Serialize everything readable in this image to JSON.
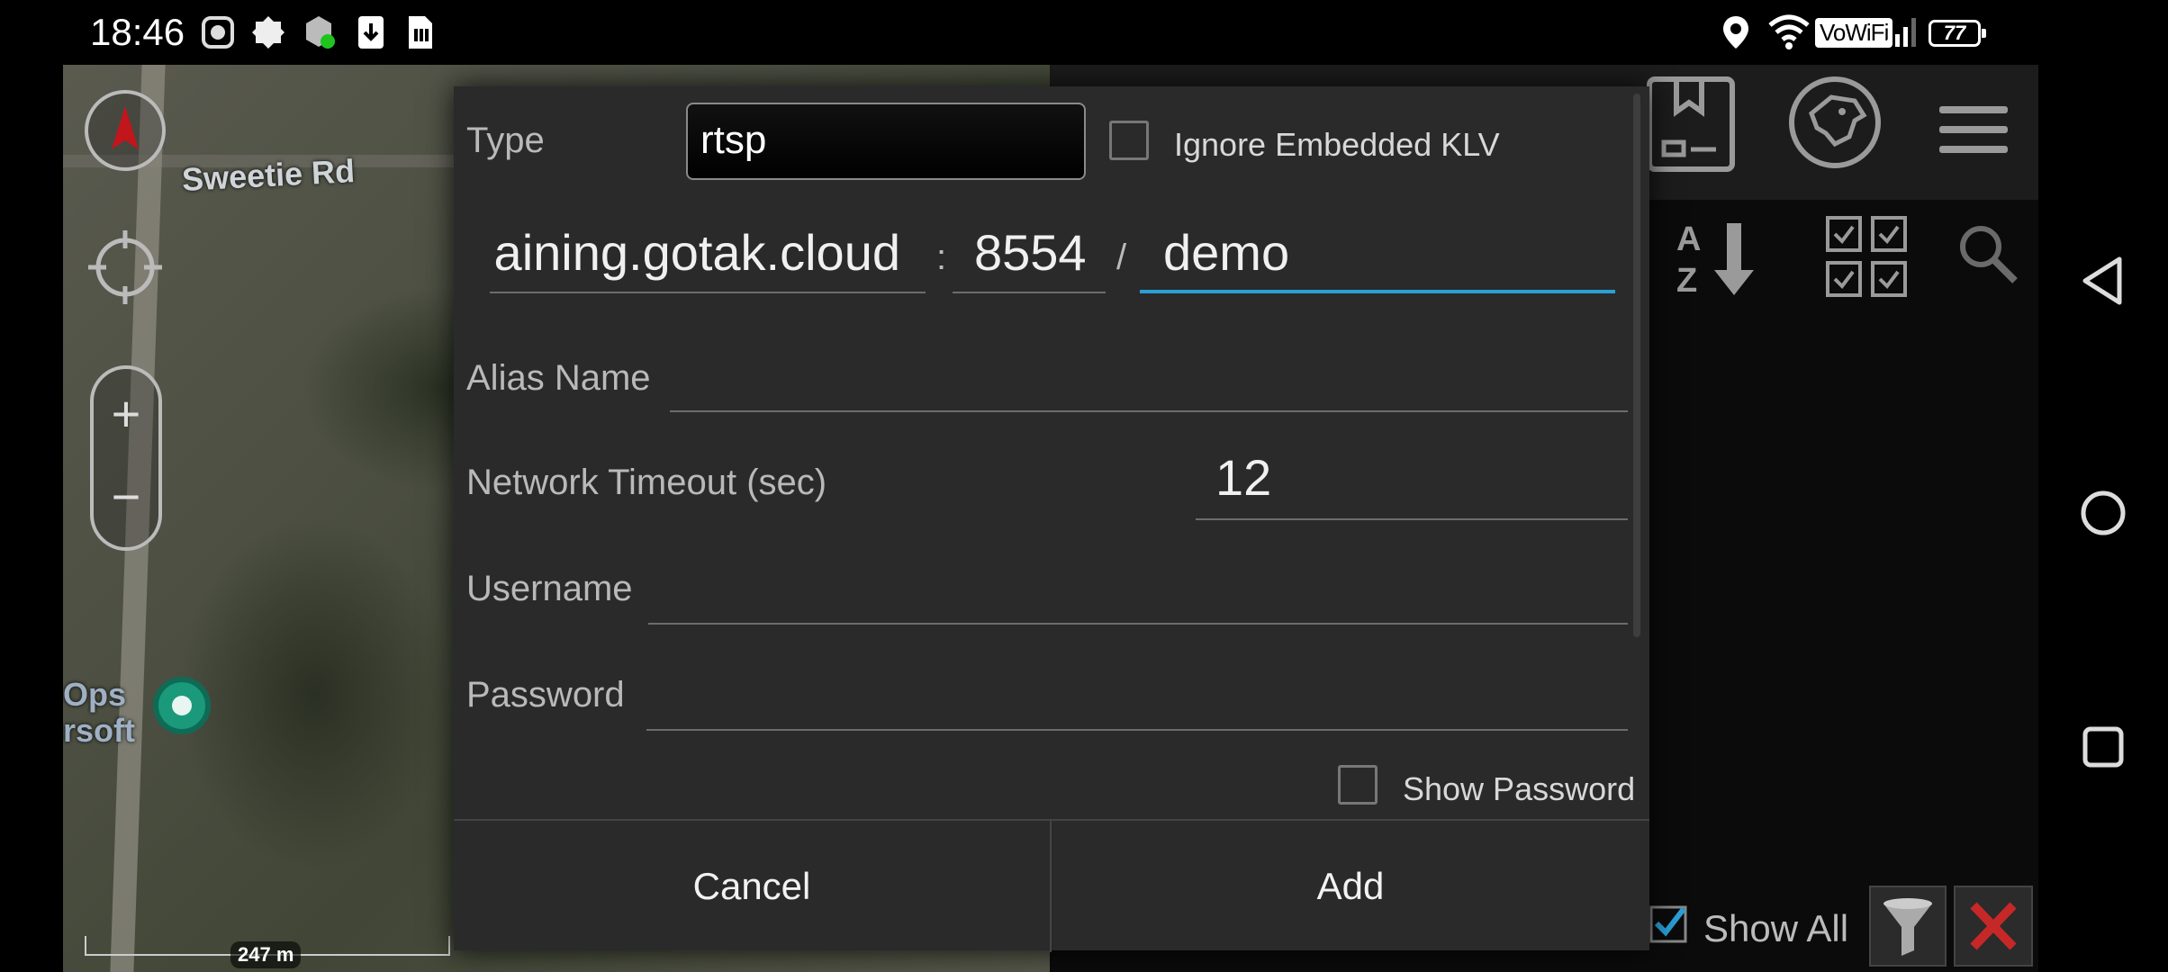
{
  "status_bar": {
    "time": "18:46",
    "network_badge": "VoWiFi",
    "battery_level": "77"
  },
  "map": {
    "street_label": "Sweetie Rd",
    "ops_label_line1": "Ops",
    "ops_label_line2": "rsoft",
    "scale_label": "247 m",
    "zoom_in_glyph": "+",
    "zoom_out_glyph": "−"
  },
  "dialog": {
    "type_label": "Type",
    "type_value": "rtsp",
    "ignore_klv_label": "Ignore Embedded KLV",
    "host_value": "aining.gotak.cloud",
    "host_port_separator": ":",
    "port_value": "8554",
    "path_separator": "/",
    "path_value": "demo",
    "alias_label": "Alias Name",
    "alias_value": "",
    "timeout_label": "Network Timeout (sec)",
    "timeout_value": "12",
    "username_label": "Username",
    "username_value": "",
    "password_label": "Password",
    "password_value": "",
    "show_password_label": "Show Password",
    "cancel_label": "Cancel",
    "add_label": "Add"
  },
  "right_panel": {
    "show_all_label": "Show All"
  },
  "colors": {
    "accent": "#2a9fd6",
    "close_red": "#c62828"
  }
}
